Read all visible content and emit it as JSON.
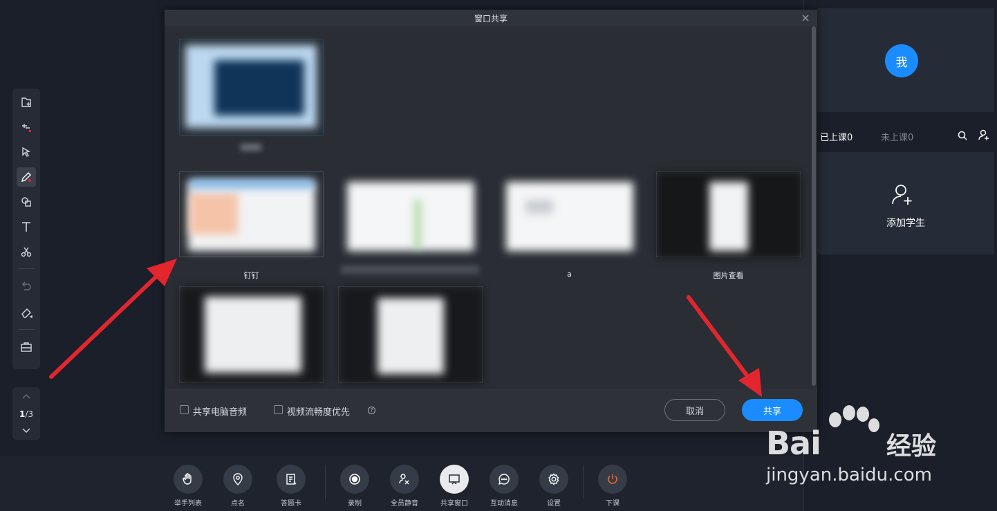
{
  "toolbar": {
    "pager_current": "1",
    "pager_total": "/3"
  },
  "right_panel": {
    "avatar_label": "我",
    "tab_attended": "已上课0",
    "tab_absent": "未上课0",
    "add_student_label": "添加学生"
  },
  "modal": {
    "title": "窗口共享",
    "window_captions": [
      "钉钉",
      "a",
      "图片查看"
    ],
    "share_audio_label": "共享电脑音频",
    "video_priority_label": "视频流畅度优先",
    "help_glyph": "?",
    "cancel_label": "取消",
    "share_label": "共享"
  },
  "bottom_bar": {
    "items": [
      {
        "label": "举手列表",
        "icon": "hand-icon"
      },
      {
        "label": "点名",
        "icon": "location-icon"
      },
      {
        "label": "答题卡",
        "icon": "answer-card-icon"
      },
      {
        "label": "录制",
        "icon": "record-icon"
      },
      {
        "label": "全员静音",
        "icon": "mute-all-icon"
      },
      {
        "label": "共享窗口",
        "icon": "share-window-icon"
      },
      {
        "label": "互动消息",
        "icon": "chat-icon"
      },
      {
        "label": "设置",
        "icon": "settings-icon"
      },
      {
        "label": "下课",
        "icon": "power-icon"
      }
    ]
  },
  "watermark": {
    "brand": "Bai",
    "brand_cn": "经验",
    "url": "jingyan.baidu.com"
  },
  "colors": {
    "accent": "#1a8cff",
    "end_class": "#e8622c",
    "annotation_arrow": "#e3262e"
  }
}
